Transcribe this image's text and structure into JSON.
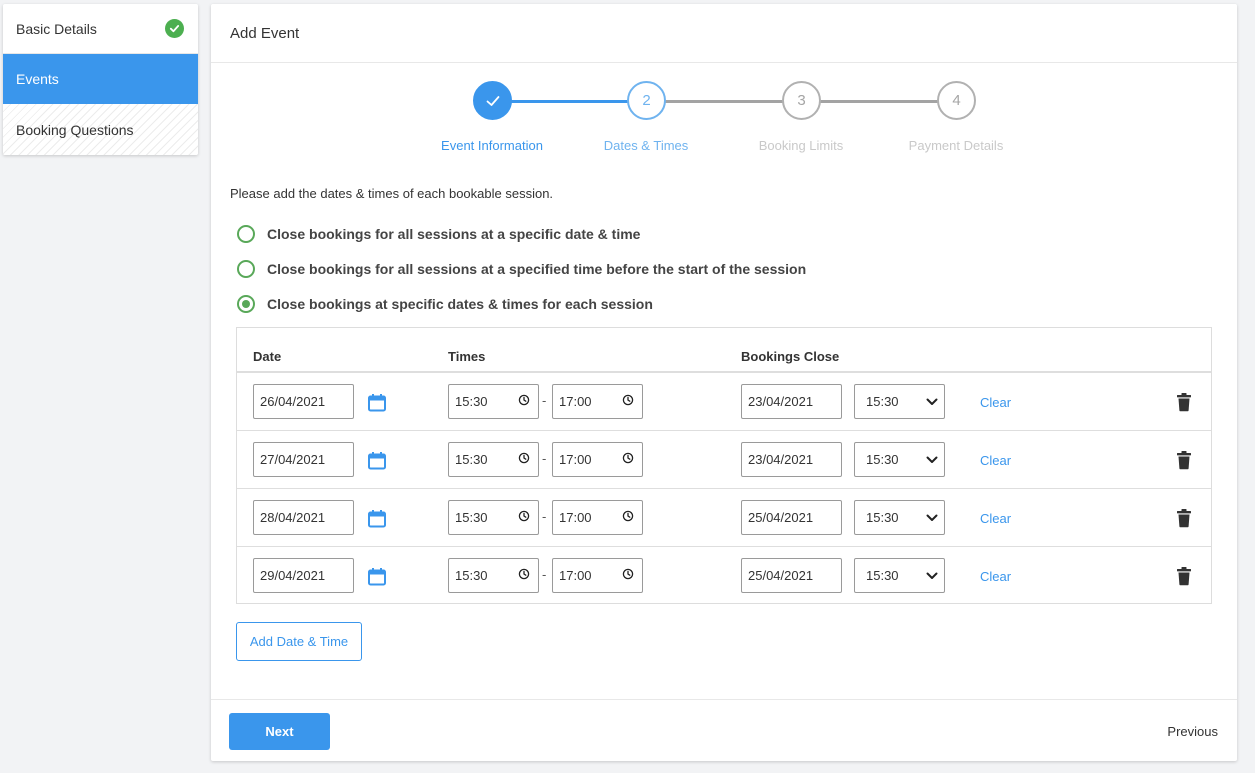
{
  "sidebar": {
    "items": [
      {
        "label": "Basic Details"
      },
      {
        "label": "Events"
      },
      {
        "label": "Booking Questions"
      }
    ]
  },
  "panel": {
    "title": "Add Event"
  },
  "stepper": {
    "steps": [
      {
        "number": "1",
        "label": "Event Information",
        "state": "done"
      },
      {
        "number": "2",
        "label": "Dates & Times",
        "state": "current"
      },
      {
        "number": "3",
        "label": "Booking Limits",
        "state": "todo"
      },
      {
        "number": "4",
        "label": "Payment Details",
        "state": "todo"
      }
    ]
  },
  "intro": "Please add the dates & times of each bookable session.",
  "options": [
    {
      "label": "Close bookings for all sessions at a specific date & time",
      "selected": false
    },
    {
      "label": "Close bookings for all sessions at a specified time before the start of the session",
      "selected": false
    },
    {
      "label": "Close bookings at specific dates & times for each session",
      "selected": true
    }
  ],
  "table": {
    "headers": {
      "date": "Date",
      "times": "Times",
      "close": "Bookings Close"
    },
    "dash": "-",
    "clear_label": "Clear",
    "rows": [
      {
        "date": "26/04/2021",
        "start": "15:30",
        "end": "17:00",
        "close_date": "23/04/2021",
        "close_time": "15:30"
      },
      {
        "date": "27/04/2021",
        "start": "15:30",
        "end": "17:00",
        "close_date": "23/04/2021",
        "close_time": "15:30"
      },
      {
        "date": "28/04/2021",
        "start": "15:30",
        "end": "17:00",
        "close_date": "25/04/2021",
        "close_time": "15:30"
      },
      {
        "date": "29/04/2021",
        "start": "15:30",
        "end": "17:00",
        "close_date": "25/04/2021",
        "close_time": "15:30"
      }
    ]
  },
  "add_button": "Add Date & Time",
  "footer": {
    "next": "Next",
    "previous": "Previous"
  },
  "colors": {
    "accent": "#3a96ec",
    "success": "#4caf50",
    "radio": "#59a859"
  }
}
